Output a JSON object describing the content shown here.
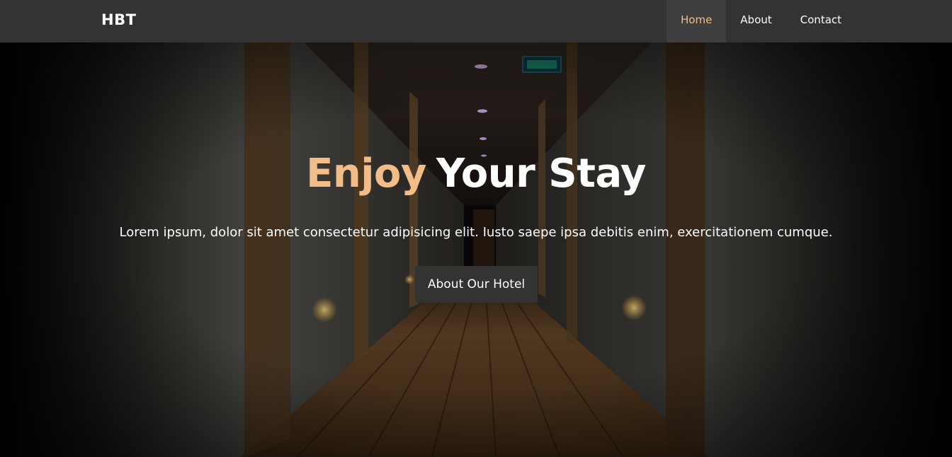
{
  "navbar": {
    "brand": "HBT",
    "links": [
      {
        "label": "Home",
        "active": true
      },
      {
        "label": "About",
        "active": false
      },
      {
        "label": "Contact",
        "active": false
      }
    ]
  },
  "hero": {
    "title_accent": "Enjoy",
    "title_rest": "Your Stay",
    "subtitle": "Lorem ipsum, dolor sit amet consectetur adipisicing elit. Iusto saepe ipsa debitis enim, exercitationem cumque.",
    "button_label": "About Our Hotel",
    "background_image": "hotel-corridor"
  },
  "colors": {
    "navbar_bg": "#333333",
    "active_link_bg": "#3f3f3f",
    "accent": "#f3bd8a",
    "text": "#ffffff",
    "button_bg": "#333333"
  }
}
